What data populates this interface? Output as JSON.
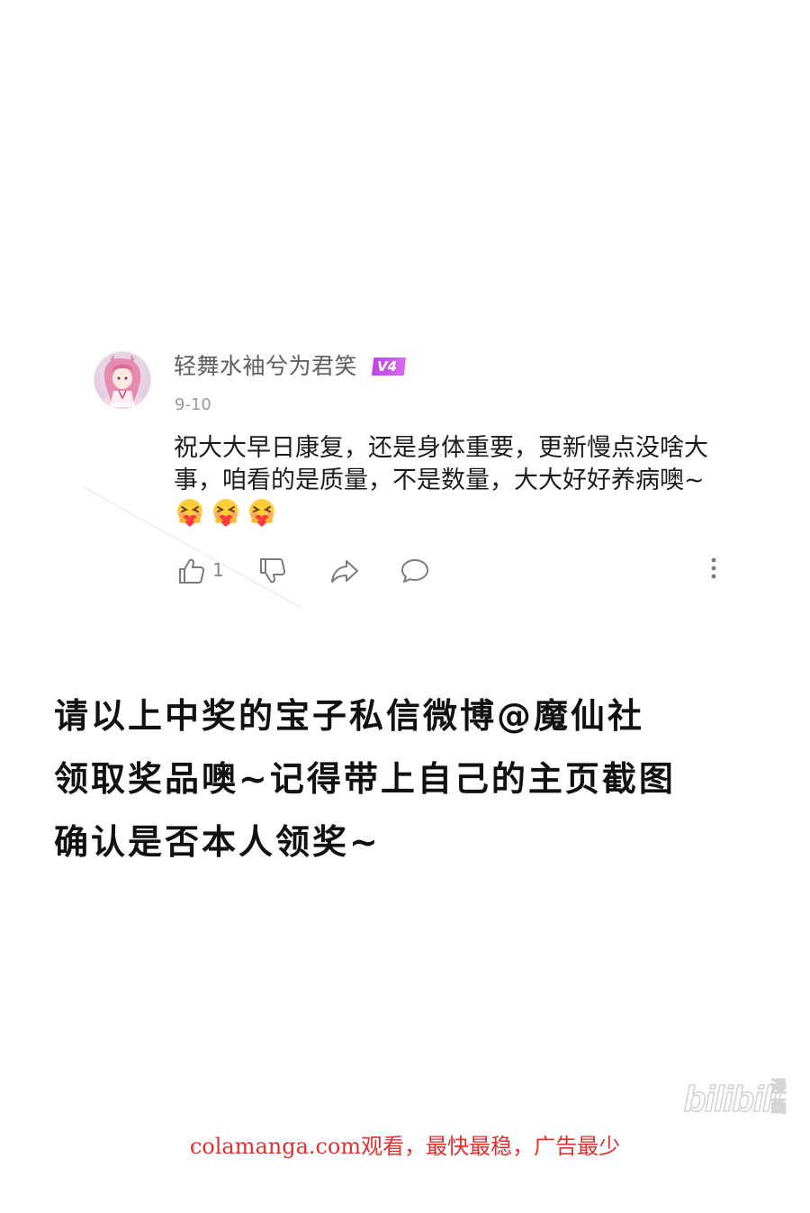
{
  "comment": {
    "username": "轻舞水袖兮为君笑",
    "vip_badge": "V4",
    "date": "9-10",
    "text": "祝大大早日康复，还是身体重要，更新慢点没啥大事，咱看的是质量，不是数量，大大好好养病噢~",
    "emoji_names": [
      "hug-heart-emoji",
      "hug-heart-emoji",
      "hug-heart-emoji"
    ],
    "like_count": "1",
    "colors": {
      "vip_badge": "#c043e3",
      "username": "#5f5f63",
      "date": "#9a9a9f",
      "icon": "#7a7a80"
    }
  },
  "notice": {
    "lines": [
      "请以上中奖的宝子私信微博@魔仙社",
      "领取奖品噢~记得带上自己的主页截图",
      "确认是否本人领奖~"
    ]
  },
  "watermark": {
    "brand": "bilibili",
    "brand_cn": "漫画"
  },
  "footer": {
    "text": "colamanga.com观看，最快最稳，广告最少",
    "color": "#e0302f"
  }
}
